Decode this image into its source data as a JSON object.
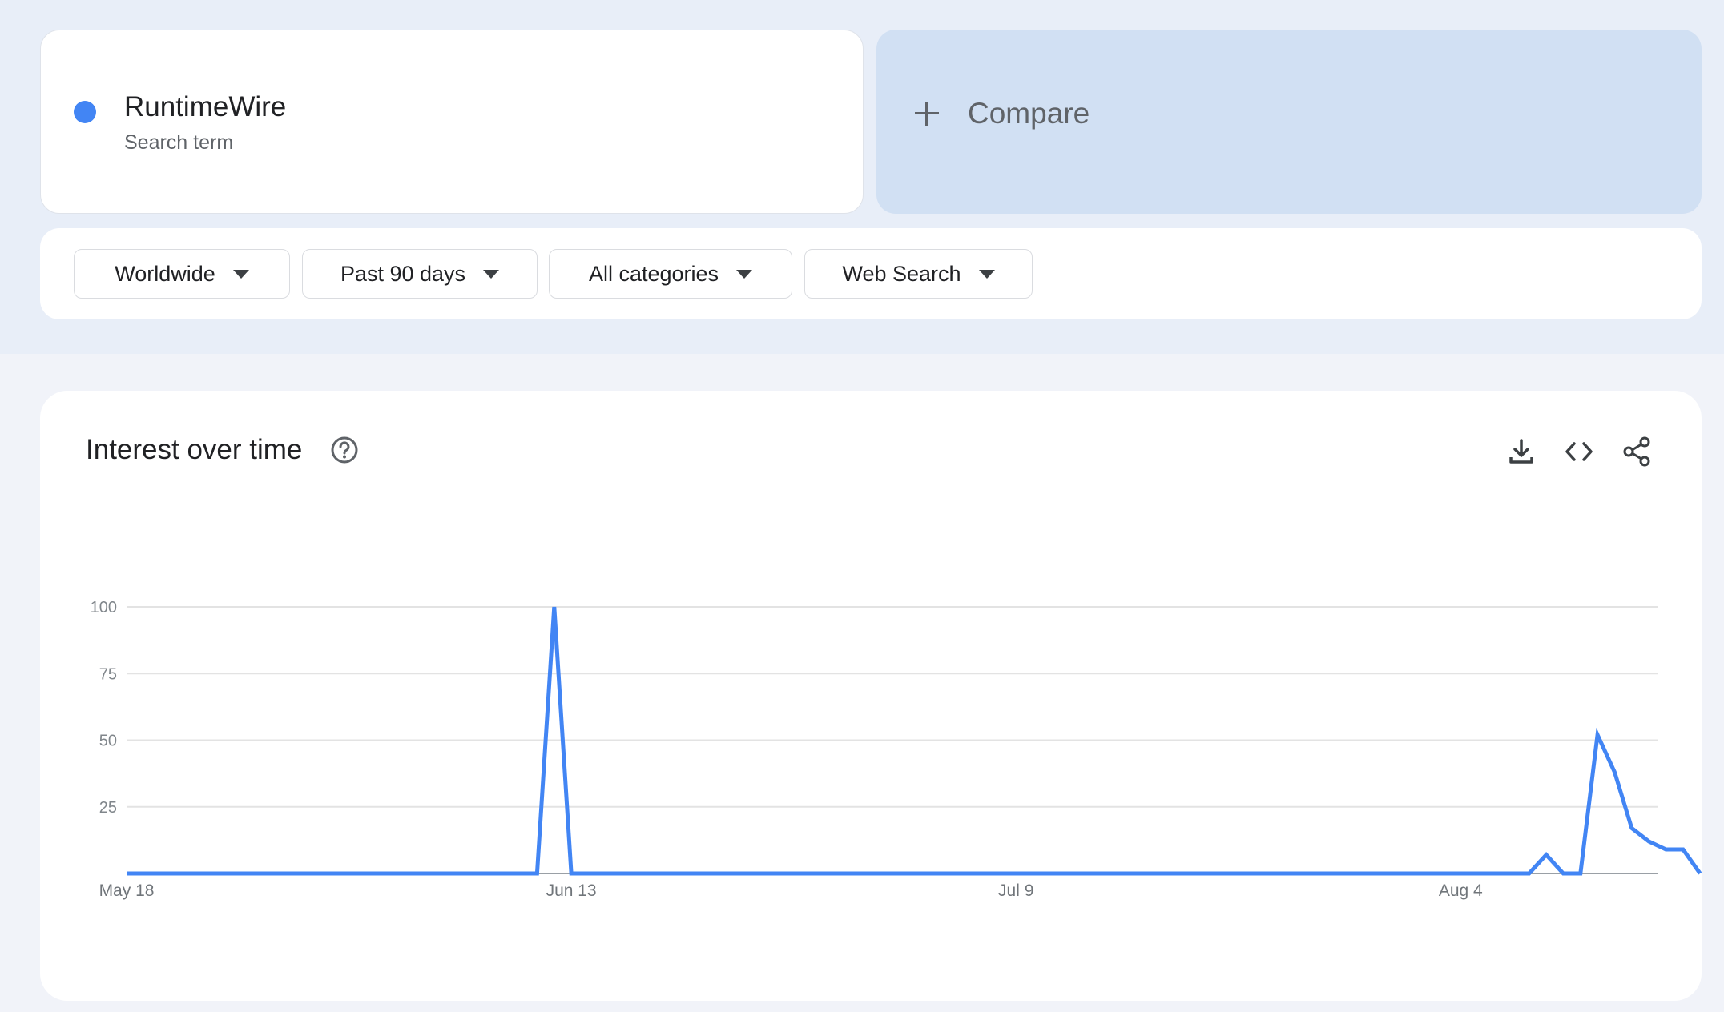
{
  "search_term": {
    "name": "RuntimeWire",
    "subtitle": "Search term",
    "color": "#4285f4"
  },
  "compare": {
    "label": "Compare"
  },
  "filters": [
    {
      "label": "Worldwide"
    },
    {
      "label": "Past 90 days"
    },
    {
      "label": "All categories"
    },
    {
      "label": "Web Search"
    }
  ],
  "chart_card": {
    "title": "Interest over time",
    "icons": [
      "help-icon",
      "download-icon",
      "embed-code-icon",
      "share-icon"
    ]
  },
  "chart_data": {
    "type": "line",
    "title": "Interest over time",
    "xlabel": "",
    "ylabel": "",
    "ylim": [
      0,
      100
    ],
    "y_ticks": [
      "100",
      "75",
      "50",
      "25"
    ],
    "x_tick_labels": [
      {
        "label": "May 18",
        "index": 0
      },
      {
        "label": "Jun 13",
        "index": 26
      },
      {
        "label": "Jul 9",
        "index": 52
      },
      {
        "label": "Aug 4",
        "index": 78
      }
    ],
    "grid": true,
    "series": [
      {
        "color": "#4285f4",
        "values": [
          0,
          0,
          0,
          0,
          0,
          0,
          0,
          0,
          0,
          0,
          0,
          0,
          0,
          0,
          0,
          0,
          0,
          0,
          0,
          0,
          0,
          0,
          0,
          0,
          0,
          100,
          0,
          0,
          0,
          0,
          0,
          0,
          0,
          0,
          0,
          0,
          0,
          0,
          0,
          0,
          0,
          0,
          0,
          0,
          0,
          0,
          0,
          0,
          0,
          0,
          0,
          0,
          0,
          0,
          0,
          0,
          0,
          0,
          0,
          0,
          0,
          0,
          0,
          0,
          0,
          0,
          0,
          0,
          0,
          0,
          0,
          0,
          0,
          0,
          0,
          0,
          0,
          0,
          0,
          0,
          0,
          0,
          0,
          7,
          0,
          0,
          52,
          38,
          17,
          12,
          9,
          9,
          0
        ]
      }
    ]
  }
}
